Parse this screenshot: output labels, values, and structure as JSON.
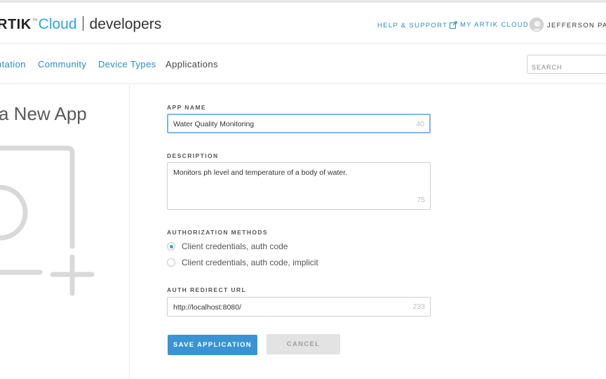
{
  "header": {
    "logo": {
      "brand": "RTIK",
      "tm": "™",
      "product": "Cloud",
      "section": "developers"
    },
    "help_support": "HELP & SUPPORT",
    "my_artik_cloud": "MY ARTIK CLOUD",
    "username": "JEFFERSON PARE"
  },
  "subnav": {
    "items": [
      "ntation",
      "Community",
      "Device Types",
      "Applications"
    ],
    "active": "Applications",
    "search_placeholder": "SEARCH"
  },
  "page": {
    "title": "a New App"
  },
  "form": {
    "app_name": {
      "label": "APP NAME",
      "value": "Water Quality Monitoring",
      "remaining": "40"
    },
    "description": {
      "label": "DESCRIPTION",
      "value": "Monitors ph level and temperature of a body of water.",
      "remaining": "75"
    },
    "auth_methods": {
      "label": "AUTHORIZATION METHODS",
      "options": [
        {
          "label": "Client credentials, auth code",
          "selected": true
        },
        {
          "label": "Client credentials, auth code, implicit",
          "selected": false
        }
      ]
    },
    "redirect_url": {
      "label": "AUTH REDIRECT URL",
      "value": "http://localhost:8080/",
      "remaining": "233"
    },
    "save_label": "SAVE APPLICATION",
    "cancel_label": "CANCEL"
  },
  "colors": {
    "accent": "#2ba6de",
    "link": "#2b8cc4",
    "primary_button": "#3a94d4",
    "focus_border": "#7fb7e6"
  },
  "icons": [
    "external-link-icon",
    "user-avatar-icon",
    "add-app-illustration"
  ]
}
